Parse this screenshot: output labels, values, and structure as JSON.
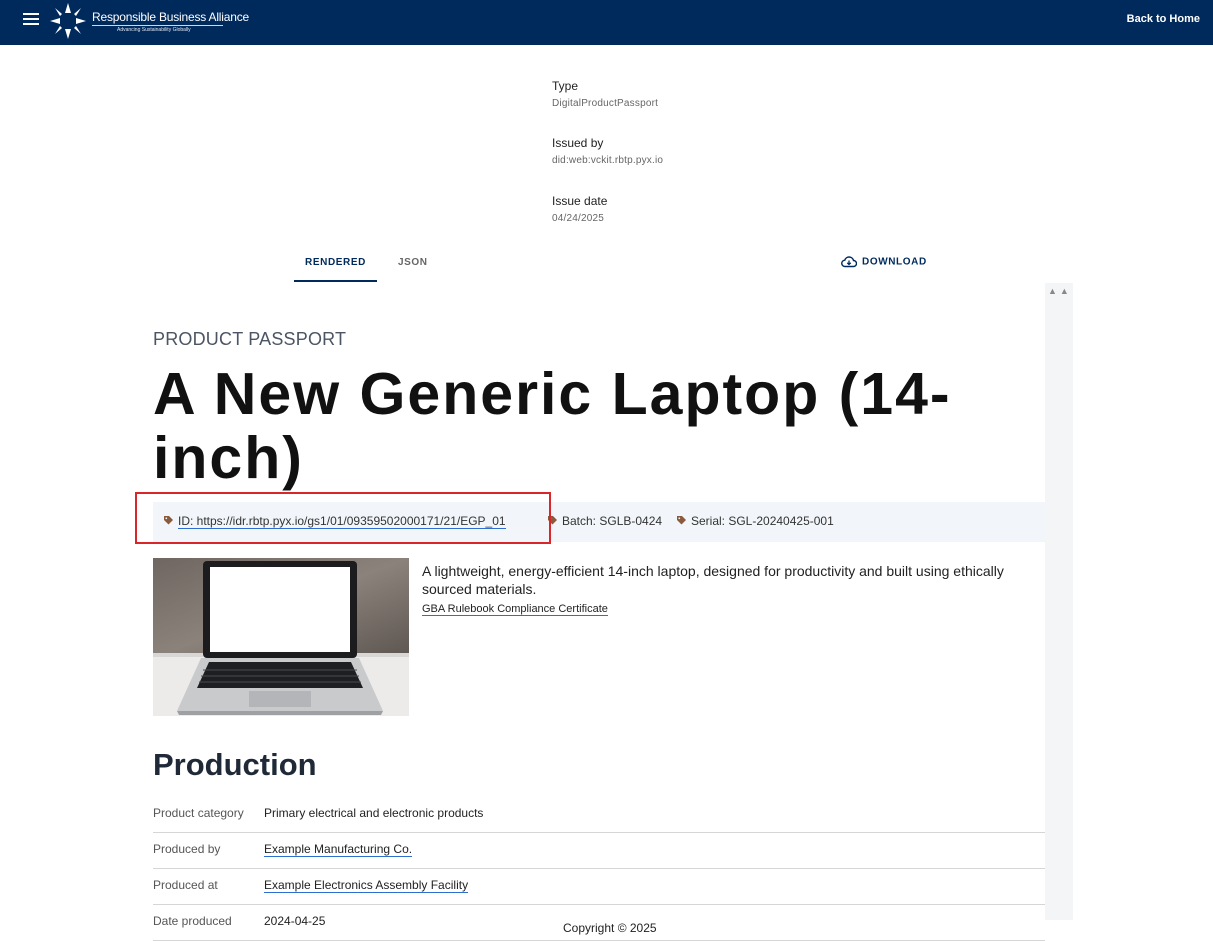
{
  "header": {
    "brand_name": "Responsible Business Alliance",
    "brand_tagline": "Advancing Sustainability Globally",
    "back_home": "Back to Home"
  },
  "credential": {
    "type_label": "Type",
    "type_value": "DigitalProductPassport",
    "issued_by_label": "Issued by",
    "issued_by_value": "did:web:vckit.rbtp.pyx.io",
    "issue_date_label": "Issue date",
    "issue_date_value": "04/24/2025"
  },
  "tabs": {
    "rendered": "RENDERED",
    "json": "JSON",
    "download": "DOWNLOAD"
  },
  "passport": {
    "kicker": "PRODUCT PASSPORT",
    "title": "A New Generic Laptop (14-inch)",
    "id": "ID: https://idr.rbtp.pyx.io/gs1/01/09359502000171/21/EGP_01",
    "batch": "Batch: SGLB-0424",
    "serial": "Serial: SGL-20240425-001",
    "description": "A lightweight, energy-efficient 14-inch laptop, designed for productivity and built using ethically sourced materials.",
    "certificate_link": "GBA Rulebook Compliance Certificate"
  },
  "production": {
    "title": "Production",
    "rows": [
      {
        "key": "Product category",
        "value": "Primary electrical and electronic products"
      },
      {
        "key": "Produced by",
        "value": "Example Manufacturing Co."
      },
      {
        "key": "Produced at",
        "value": "Example Electronics Assembly Facility"
      },
      {
        "key": "Date produced",
        "value": "2024-04-25"
      }
    ]
  },
  "footer": {
    "copyright": "Copyright © 2025"
  },
  "colors": {
    "navy": "#002a5c",
    "link_underline": "#2d6fd1",
    "tag_icon": "#8a5a3c",
    "highlight": "#d9262b"
  }
}
